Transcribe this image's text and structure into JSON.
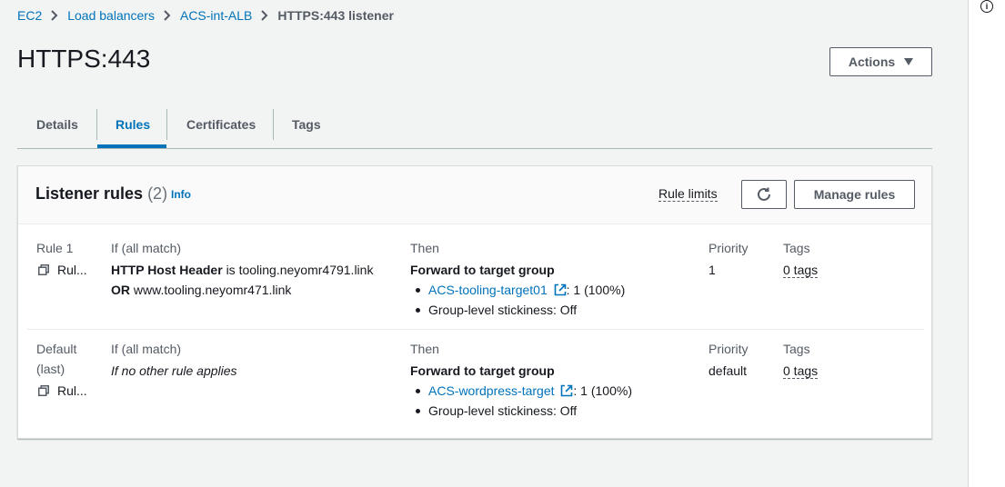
{
  "breadcrumb": {
    "items": [
      "EC2",
      "Load balancers",
      "ACS-int-ALB"
    ],
    "current": "HTTPS:443 listener"
  },
  "page": {
    "title": "HTTPS:443"
  },
  "actions": {
    "label": "Actions"
  },
  "tabs": [
    {
      "label": "Details",
      "active": false
    },
    {
      "label": "Rules",
      "active": true
    },
    {
      "label": "Certificates",
      "active": false
    },
    {
      "label": "Tags",
      "active": false
    }
  ],
  "panel": {
    "title": "Listener rules",
    "count": "(2)",
    "info": "Info",
    "rule_limits": "Rule limits",
    "manage_rules": "Manage rules"
  },
  "columns": {
    "condition": "If (all match)",
    "then": "Then",
    "priority": "Priority",
    "tags": "Tags"
  },
  "rules": [
    {
      "name": "Rule 1",
      "name_line2": "",
      "arn": "Rul...",
      "condition_key": "HTTP Host Header",
      "condition_is": "is",
      "condition_value": "tooling.neyomr4791.link",
      "condition_or": "OR",
      "condition_or_value": "www.tooling.neyomr471.link",
      "action": "Forward to target group",
      "target": "ACS-tooling-target01",
      "target_weight": ": 1 (100%)",
      "stickiness": "Group-level stickiness: Off",
      "priority": "1",
      "tags": "0 tags"
    },
    {
      "name": "Default",
      "name_line2": "(last)",
      "arn": "Rul...",
      "condition_default": "If no other rule applies",
      "action": "Forward to target group",
      "target": "ACS-wordpress-target",
      "target_weight": ": 1 (100%)",
      "stickiness": "Group-level stickiness: Off",
      "priority": "default",
      "tags": "0 tags"
    }
  ],
  "colors": {
    "link": "#0073bb",
    "background": "#f2f3f3",
    "text": "#16191f"
  },
  "icons": [
    "chevron-right-icon",
    "caret-down-icon",
    "refresh-icon",
    "copy-icon",
    "external-link-icon",
    "info-icon"
  ]
}
